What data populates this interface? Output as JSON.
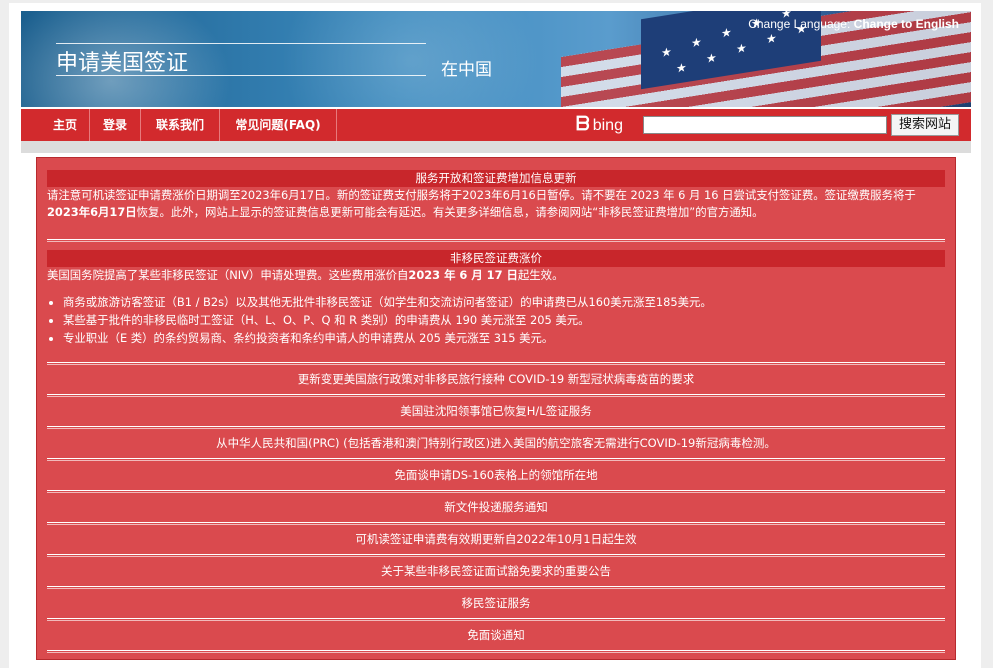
{
  "header": {
    "title": "申请美国签证",
    "subtitle": "在中国",
    "change_language_label": "Change Language:",
    "change_language_link": "Change to English"
  },
  "nav": {
    "items": [
      {
        "label": "主页"
      },
      {
        "label": "登录"
      },
      {
        "label": "联系我们"
      },
      {
        "label": "常见问题(FAQ)"
      }
    ],
    "bing_label": "bing",
    "search_placeholder": "",
    "search_button": "搜索网站"
  },
  "notices": {
    "fee_update": {
      "header": "服务开放和签证费增加信息更新",
      "text_part1": "请注意可机读签证申请费涨价日期调至2023年6月17日。新的签证费支付服务将于2023年6月16日暂停。请不要在 2023 年 6 月 16 日尝试支付签证费。签证缴费服务将于",
      "text_bold": "2023年6月17日",
      "text_part2": "恢复。此外，网站上显示的签证费信息更新可能会有延迟。有关更多详细信息，请参阅网站“非移民签证费增加”的官方通知。"
    },
    "niv_fee": {
      "header": "非移民签证费涨价",
      "intro_part1": "美国国务院提高了某些非移民签证（NIV）申请处理费。这些费用涨价自",
      "intro_bold": "2023 年 6 月 17 日",
      "intro_part2": "起生效。",
      "bullets": [
        "商务或旅游访客签证（B1 / B2s）以及其他无批件非移民签证（如学生和交流访问者签证）的申请费已从160美元涨至185美元。",
        "某些基于批件的非移民临时工签证（H、L、O、P、Q 和 R 类别）的申请费从 190 美元涨至 205 美元。",
        "专业职业（E 类）的条约贸易商、条约投资者和条约申请人的申请费从 205 美元涨至 315 美元。"
      ]
    },
    "links": [
      "更新变更美国旅行政策对非移民旅行接种 COVID-19 新型冠状病毒疫苗的要求",
      "美国驻沈阳领事馆已恢复H/L签证服务",
      "从中华人民共和国(PRC) (包括香港和澳门特别行政区)进入美国的航空旅客无需进行COVID-19新冠病毒检测。",
      "免面谈申请DS-160表格上的领馆所在地",
      "新文件投递服务通知",
      "可机读签证申请费有效期更新自2022年10月1日起生效",
      "关于某些非移民签证面试豁免要求的重要公告",
      "移民签证服务",
      "免面谈通知"
    ]
  },
  "colors": {
    "nav_red": "#d22a2d",
    "content_red": "#da4a4e",
    "header_red": "#c8262b"
  }
}
